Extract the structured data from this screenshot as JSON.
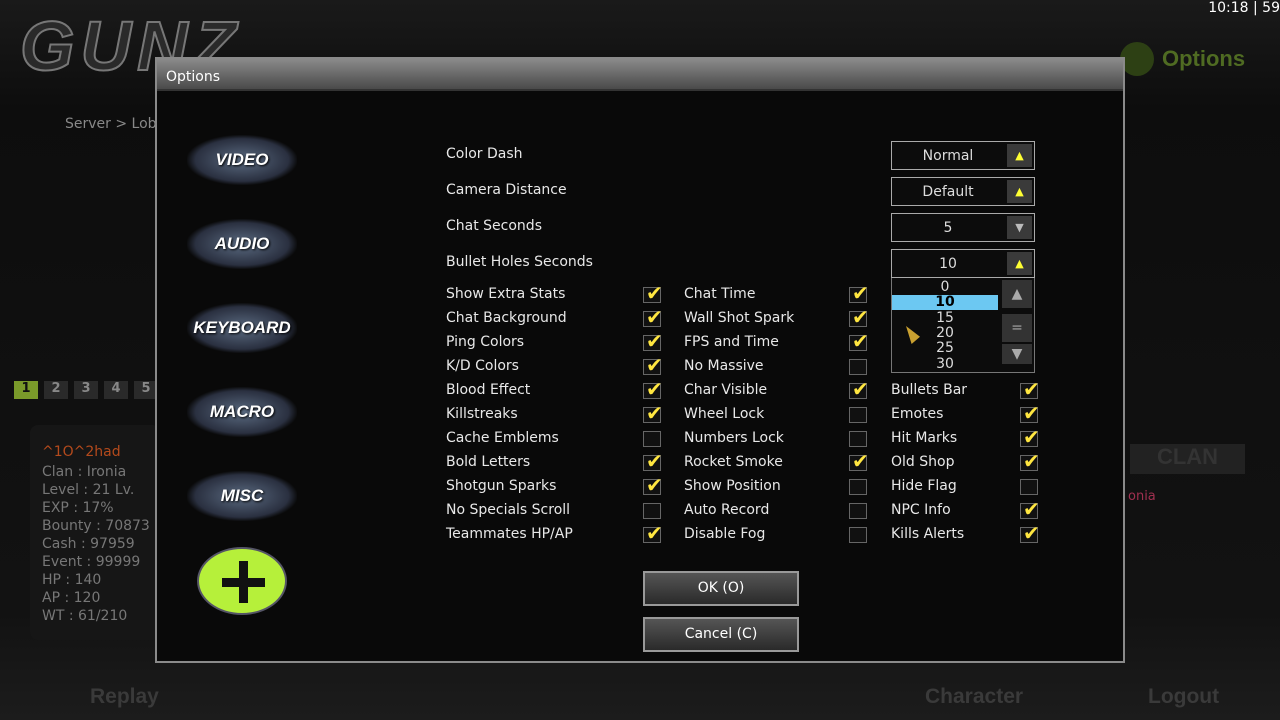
{
  "window": {
    "logo": "GUNZ",
    "clock": "10:18 |  59",
    "top_button": "Options",
    "breadcrumb": "Server > Lobby",
    "pages": [
      "1",
      "2",
      "3",
      "4",
      "5"
    ],
    "active_page": "1"
  },
  "player": {
    "name": "^1O^2had",
    "lines": [
      "Clan : Ironia",
      "Level : 21 Lv.",
      "EXP : 17%",
      "Bounty : 70873",
      "Cash : 97959",
      "Event : 99999",
      "HP : 140",
      "AP : 120",
      "WT : 61/210"
    ]
  },
  "right_panel": {
    "clan_tab": "CLAN",
    "clan_text": "onia"
  },
  "bottom_nav": {
    "replay": "Replay",
    "character": "Character",
    "logout": "Logout"
  },
  "dialog": {
    "title": "Options",
    "categories": [
      "VIDEO",
      "AUDIO",
      "KEYBOARD",
      "MACRO",
      "MISC"
    ],
    "dropdowns": [
      {
        "label": "Color Dash",
        "value": "Normal",
        "arrow": "up"
      },
      {
        "label": "Camera Distance",
        "value": "Default",
        "arrow": "up"
      },
      {
        "label": "Chat Seconds",
        "value": "5",
        "arrow": "down"
      },
      {
        "label": "Bullet Holes Seconds",
        "value": "10",
        "arrow": "up"
      }
    ],
    "open_list": {
      "options": [
        "0",
        "10",
        "15",
        "20",
        "25",
        "30"
      ],
      "selected": "10"
    },
    "col1": [
      [
        "Show Extra Stats",
        true
      ],
      [
        "Chat Background",
        true
      ],
      [
        "Ping Colors",
        true
      ],
      [
        "K/D Colors",
        true
      ],
      [
        "Blood Effect",
        true
      ],
      [
        "Killstreaks",
        true
      ],
      [
        "Cache Emblems",
        false
      ],
      [
        "Bold Letters",
        true
      ],
      [
        "Shotgun Sparks",
        true
      ],
      [
        "No Specials Scroll",
        false
      ],
      [
        "Teammates HP/AP",
        true
      ]
    ],
    "col2": [
      [
        "Chat Time",
        true
      ],
      [
        "Wall Shot Spark",
        true
      ],
      [
        "FPS and Time",
        true
      ],
      [
        "No Massive",
        false
      ],
      [
        "Char Visible",
        true
      ],
      [
        "Wheel Lock",
        false
      ],
      [
        "Numbers Lock",
        false
      ],
      [
        "Rocket Smoke",
        true
      ],
      [
        "Show Position",
        false
      ],
      [
        "Auto Record",
        false
      ],
      [
        "Disable Fog",
        false
      ]
    ],
    "col3": [
      [
        "Bullets Bar",
        true
      ],
      [
        "Emotes",
        true
      ],
      [
        "Hit Marks",
        true
      ],
      [
        "Old Shop",
        true
      ],
      [
        "Hide Flag",
        false
      ],
      [
        "NPC Info",
        true
      ],
      [
        "Kills Alerts",
        true
      ]
    ],
    "ok": "OK (O)",
    "cancel": "Cancel (C)"
  },
  "colors": {
    "check": "#ffe640",
    "selected": "#6cc8f2",
    "accent_green": "#b6f03a"
  }
}
